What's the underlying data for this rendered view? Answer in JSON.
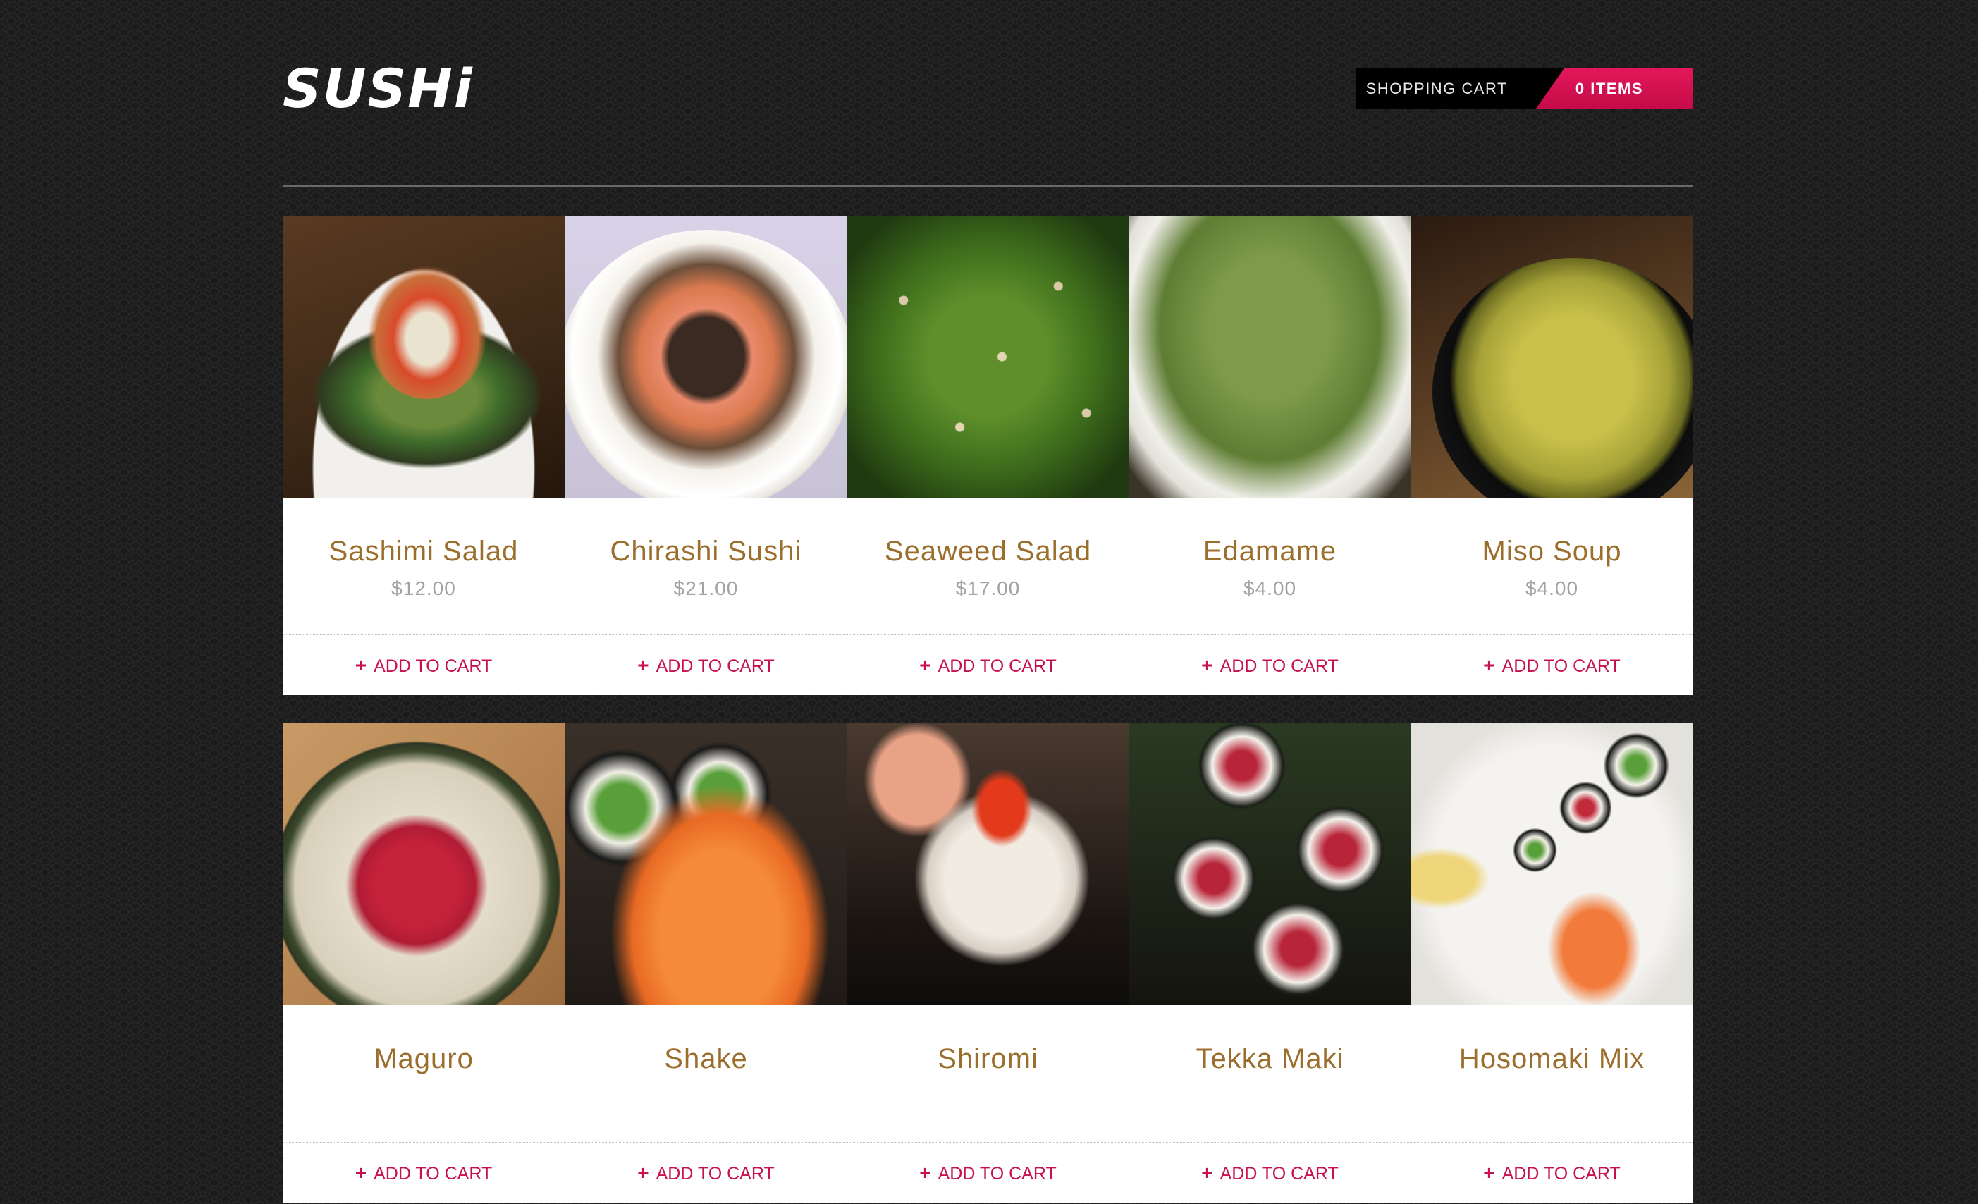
{
  "header": {
    "logo_text": "SUSHi",
    "cart_label": "SHOPPING CART",
    "cart_count": "0 ITEMS"
  },
  "colors": {
    "accent": "#c8104e",
    "product_name": "#9c6e2c",
    "price": "#a2a2a2",
    "background": "#1b1b1b"
  },
  "add_label": "ADD TO CART",
  "products": [
    {
      "name": "Sashimi Salad",
      "price": "$12.00"
    },
    {
      "name": "Chirashi Sushi",
      "price": "$21.00"
    },
    {
      "name": "Seaweed Salad",
      "price": "$17.00"
    },
    {
      "name": "Edamame",
      "price": "$4.00"
    },
    {
      "name": "Miso Soup",
      "price": "$4.00"
    },
    {
      "name": "Maguro",
      "price": ""
    },
    {
      "name": "Shake",
      "price": ""
    },
    {
      "name": "Shiromi",
      "price": ""
    },
    {
      "name": "Tekka Maki",
      "price": ""
    },
    {
      "name": "Hosomaki Mix",
      "price": ""
    }
  ]
}
